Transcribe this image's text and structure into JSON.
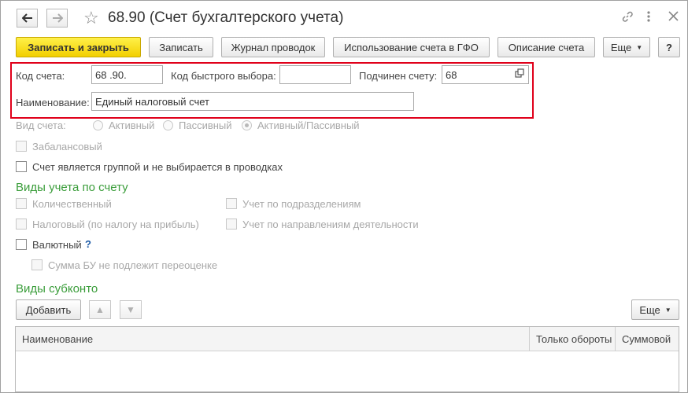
{
  "window": {
    "title": "68.90 (Счет бухгалтерского учета)",
    "back_icon": "arrow-left",
    "forward_icon": "arrow-right",
    "star_icon": "star",
    "link_icon": "link",
    "more_icon": "vertical-dots",
    "close_icon": "close"
  },
  "toolbar": {
    "save_close": "Записать и закрыть",
    "save": "Записать",
    "journal": "Журнал проводок",
    "usage": "Использование счета в ГФО",
    "description": "Описание счета",
    "more": "Еще",
    "help": "?"
  },
  "form": {
    "code_label": "Код счета:",
    "code_value": "68 .90.",
    "quick_code_label": "Код быстрого выбора:",
    "quick_code_value": "",
    "parent_label": "Подчинен счету:",
    "parent_value": "68",
    "name_label": "Наименование:",
    "name_value": "Единый налоговый счет",
    "type_label": "Вид счета:",
    "type_active": "Активный",
    "type_passive": "Пассивный",
    "type_active_passive": "Активный/Пассивный",
    "type_selected": "Активный/Пассивный",
    "offbalance": "Забалансовый",
    "is_group": "Счет является группой и не выбирается в проводках"
  },
  "accounting_types": {
    "title": "Виды учета по счету",
    "quantitative": "Количественный",
    "tax": "Налоговый (по налогу на прибыль)",
    "currency": "Валютный",
    "currency_help": "?",
    "no_revaluation": "Сумма БУ не подлежит переоценке",
    "by_departments": "Учет по подразделениям",
    "by_activities": "Учет по направлениям деятельности"
  },
  "subconto": {
    "title": "Виды субконто",
    "add": "Добавить",
    "more": "Еще",
    "columns": [
      "Наименование",
      "Только обороты",
      "Суммовой"
    ],
    "rows": []
  }
}
